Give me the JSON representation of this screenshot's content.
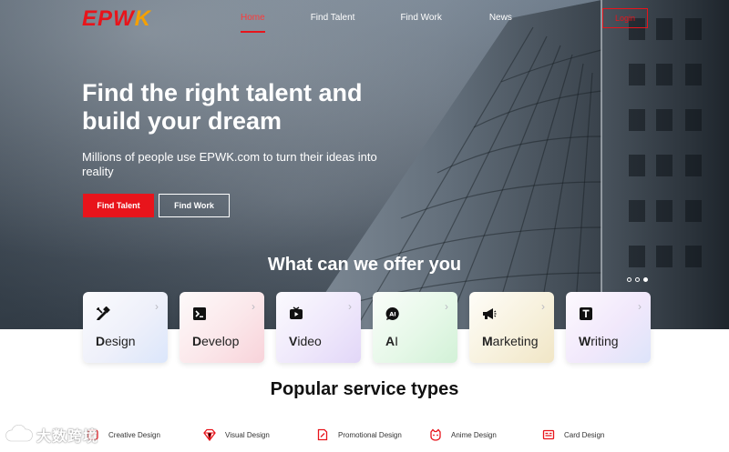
{
  "brand": {
    "logo_main": "EPW",
    "logo_accent": "K"
  },
  "nav": {
    "items": [
      {
        "label": "Home"
      },
      {
        "label": "Find Talent"
      },
      {
        "label": "Find Work"
      },
      {
        "label": "News"
      }
    ],
    "active_index": 0,
    "login_label": "Login"
  },
  "hero": {
    "title": "Find the right talent and build your dream",
    "subtitle": "Millions of people use EPWK.com to turn their ideas into reality",
    "primary_button": "Find Talent",
    "secondary_button": "Find Work",
    "carousel_active": 3,
    "carousel_count": 3
  },
  "offer": {
    "title": "What can we offer you",
    "categories": [
      {
        "label": "Design",
        "icon": "pen-ruler-icon"
      },
      {
        "label": "Develop",
        "icon": "terminal-icon"
      },
      {
        "label": "Video",
        "icon": "play-screen-icon"
      },
      {
        "label": "AI",
        "icon": "ai-chip-icon"
      },
      {
        "label": "Marketing",
        "icon": "megaphone-icon"
      },
      {
        "label": "Writing",
        "icon": "text-t-icon"
      }
    ]
  },
  "popular": {
    "title": "Popular service types",
    "items": [
      {
        "label": "Creative Design",
        "icon": "creative-icon"
      },
      {
        "label": "Visual Design",
        "icon": "diamond-icon"
      },
      {
        "label": "Promotional Design",
        "icon": "document-edit-icon"
      },
      {
        "label": "Anime Design",
        "icon": "anime-face-icon"
      },
      {
        "label": "Card Design",
        "icon": "card-icon"
      }
    ]
  },
  "watermark": {
    "text": "大数跨境"
  },
  "colors": {
    "accent": "#e8141b",
    "logo_secondary": "#f5a000"
  }
}
